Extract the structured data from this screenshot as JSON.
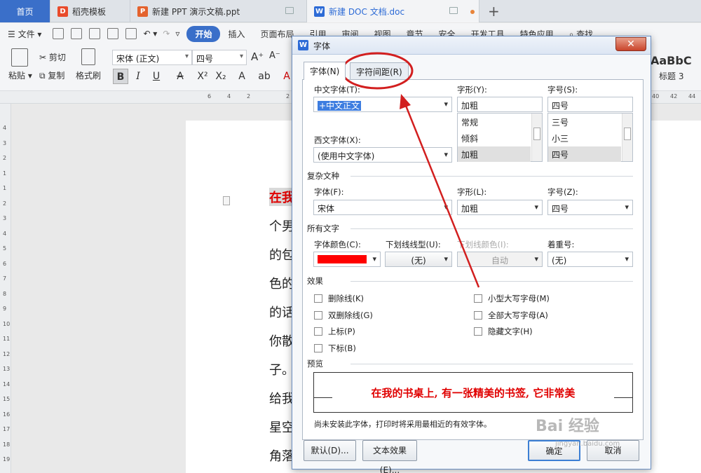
{
  "tabs": [
    {
      "label": "首页"
    },
    {
      "label": "稻壳模板"
    },
    {
      "label": "新建 PPT 演示文稿.ppt"
    },
    {
      "label": "新建 DOC 文档.doc"
    }
  ],
  "menu": {
    "file": "文件",
    "start": "开始",
    "insert": "插入",
    "layout": "页面布局",
    "ref": "引用",
    "review": "审阅",
    "view": "视图",
    "section": "章节",
    "security": "安全",
    "devtools": "开发工具",
    "special": "特色应用",
    "search": "查找"
  },
  "ribbon": {
    "paste": "粘贴",
    "cut": "剪切",
    "copy": "复制",
    "format_painter": "格式刷",
    "font_name": "宋体 (正文)",
    "font_size": "四号",
    "style_preview": "AaBbC",
    "style_name": "标题 3"
  },
  "ruler_numbers": [
    "6",
    "4",
    "2",
    "2",
    "40",
    "42",
    "44"
  ],
  "vruler_numbers": [
    "4",
    "3",
    "2",
    "1",
    "1",
    "2",
    "3",
    "4",
    "5",
    "6",
    "7",
    "8",
    "9",
    "10",
    "11",
    "12",
    "13",
    "14",
    "15",
    "16",
    "17",
    "18",
    "19"
  ],
  "document_lines": [
    "在我",
    "个男",
    "的包",
    "色的",
    "的话",
    "你散",
    "子。",
    "给我",
    "星空",
    "角落"
  ],
  "dialog": {
    "title": "字体",
    "close": "✕",
    "tabs": {
      "font": "字体(N)",
      "spacing": "字符间距(R)"
    },
    "chinese_font_label": "中文字体(T):",
    "chinese_font_value": "+中文正文",
    "western_font_label": "西文字体(X):",
    "western_font_value": "(使用中文字体)",
    "style_label": "字形(Y):",
    "style_value": "加粗",
    "style_options": [
      "常规",
      "倾斜",
      "加粗"
    ],
    "size_label": "字号(S):",
    "size_value": "四号",
    "size_options": [
      "三号",
      "小三",
      "四号"
    ],
    "complex_section": "复杂文种",
    "complex_font_label": "字体(F):",
    "complex_font_value": "宋体",
    "complex_style_label": "字形(L):",
    "complex_style_value": "加粗",
    "complex_size_label": "字号(Z):",
    "complex_size_value": "四号",
    "all_text_section": "所有文字",
    "font_color_label": "字体颜色(C):",
    "font_color": "#ff0000",
    "underline_type_label": "下划线线型(U):",
    "underline_type_value": "(无)",
    "underline_color_label": "下划线颜色(I):",
    "underline_color_value": "自动",
    "emphasis_label": "着重号:",
    "emphasis_value": "(无)",
    "effects_section": "效果",
    "effects": {
      "strike": "删除线(K)",
      "double_strike": "双删除线(G)",
      "superscript": "上标(P)",
      "subscript": "下标(B)",
      "small_caps": "小型大写字母(M)",
      "all_caps": "全部大写字母(A)",
      "hidden": "隐藏文字(H)"
    },
    "preview_section": "预览",
    "preview_text": "在我的书桌上, 有一张精美的书签, 它非常美",
    "notice": "尚未安装此字体，打印时将采用最相近的有效字体。",
    "buttons": {
      "default": "默认(D)...",
      "text_effect": "文本效果(E)...",
      "ok": "确定",
      "cancel": "取消"
    }
  },
  "watermark": {
    "brand": "Bai 经验",
    "url": "jingyan.baidu.com"
  },
  "colors": {
    "accent": "#3a6fc9",
    "annotation": "#d21f1f"
  }
}
